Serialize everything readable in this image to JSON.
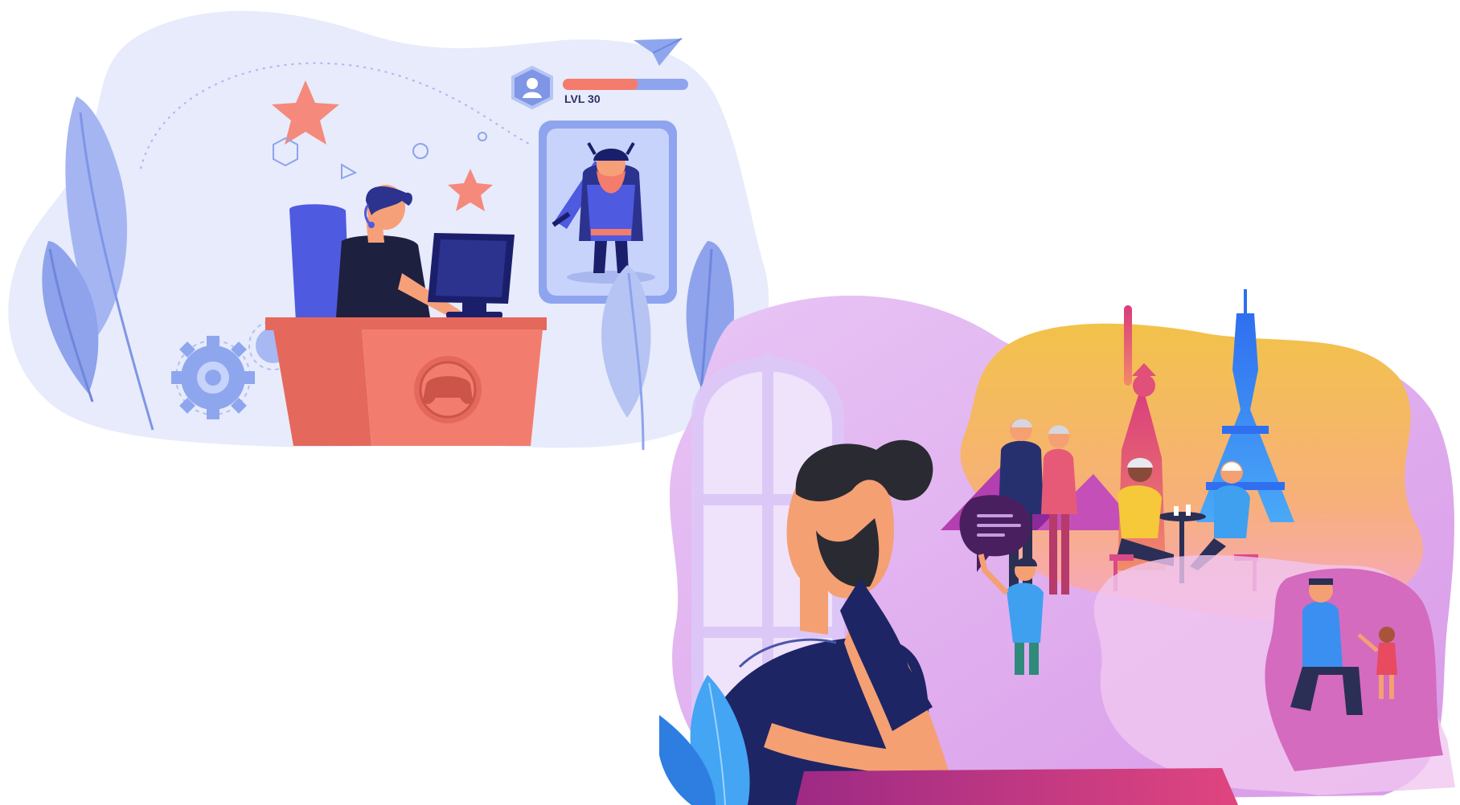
{
  "gaming_scene": {
    "level_label": "LVL 30",
    "level_progress": 0.6,
    "colors": {
      "blob": "#e7ebfb",
      "desk": "#f27d6e",
      "desk_dark": "#e5685c",
      "chair": "#4e5ae0",
      "monitor": "#1b1f6b",
      "shirt": "#1e2040",
      "star": "#f5897c",
      "card_frame": "#8fa4ef",
      "card_bg": "#c7d3fb",
      "leaf": "#9eb2f3",
      "gear": "#8ea6ee",
      "progress_fill": "#f47c6c",
      "progress_track": "#8fa4ef"
    },
    "icons": [
      "user-avatar-icon",
      "paper-plane-icon",
      "star-icon",
      "gear-icon",
      "gamepad-icon",
      "viking-warrior-icon"
    ]
  },
  "dreaming_scene": {
    "colors": {
      "blob": "#e6b3f3",
      "window": "#d8c3f7",
      "sky_top": "#f2c24a",
      "sky_bottom": "#f7a6c8",
      "eiffel": "#3a7cf0",
      "statue": "#e0507a",
      "pyramid": "#b43fb0",
      "shirt": "#1d2564",
      "skin": "#f4a073",
      "beard": "#2a2a33",
      "desk": "#c23a8a",
      "leaf": "#43a5f4"
    },
    "icons": [
      "statue-of-liberty-icon",
      "eiffel-tower-icon",
      "pyramids-icon",
      "speech-bubble-icon"
    ]
  }
}
